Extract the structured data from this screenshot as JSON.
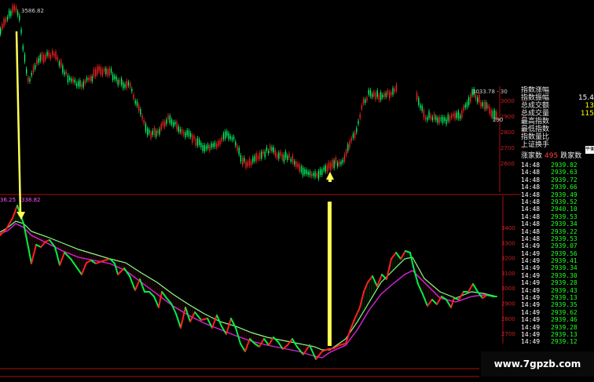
{
  "upper_chart": {
    "peak_label": "3586.82",
    "right_label": "3033.78 - 30",
    "right_value": "290",
    "axis_ticks": [
      "3000",
      "2900",
      "2800",
      "2700",
      "2600"
    ]
  },
  "lower_chart": {
    "top_label_left": "36.25",
    "top_label_right": "338.82",
    "axis_ticks": [
      "3400",
      "3300",
      "3200",
      "3100",
      "3000",
      "2900",
      "2800",
      "2700"
    ]
  },
  "info_panel": {
    "rows": [
      {
        "label": "指数涨幅",
        "value": ""
      },
      {
        "label": "指数振幅",
        "value": "15.4"
      },
      {
        "label": "总成交额",
        "value": "13"
      },
      {
        "label": "总成交量",
        "value": "115"
      },
      {
        "label": "最高指数",
        "value": ""
      },
      {
        "label": "最低指数",
        "value": ""
      },
      {
        "label": "指数量比",
        "value": ""
      },
      {
        "label": "上证换手",
        "value": ""
      }
    ],
    "advance_label": "涨家数",
    "advance_count": "495",
    "decline_label": "跌家数"
  },
  "ticks": [
    {
      "time": "14:48",
      "price": "2939.82"
    },
    {
      "time": "14:48",
      "price": "2939.63"
    },
    {
      "time": "14:48",
      "price": "2939.72"
    },
    {
      "time": "14:48",
      "price": "2939.66"
    },
    {
      "time": "14:48",
      "price": "2939.49"
    },
    {
      "time": "14:48",
      "price": "2939.52"
    },
    {
      "time": "14:48",
      "price": "2940.10"
    },
    {
      "time": "14:48",
      "price": "2939.53"
    },
    {
      "time": "14:48",
      "price": "2939.34"
    },
    {
      "time": "14:48",
      "price": "2939.22"
    },
    {
      "time": "14:48",
      "price": "2939.53"
    },
    {
      "time": "14:49",
      "price": "2939.07"
    },
    {
      "time": "14:49",
      "price": "2939.56"
    },
    {
      "time": "14:49",
      "price": "2939.41"
    },
    {
      "time": "14:49",
      "price": "2939.34"
    },
    {
      "time": "14:49",
      "price": "2939.30"
    },
    {
      "time": "14:49",
      "price": "2939.28"
    },
    {
      "time": "14:49",
      "price": "2939.43"
    },
    {
      "time": "14:49",
      "price": "2939.13"
    },
    {
      "time": "14:49",
      "price": "2939.35"
    },
    {
      "time": "14:49",
      "price": "2939.62"
    },
    {
      "time": "14:49",
      "price": "2939.46"
    },
    {
      "time": "14:49",
      "price": "2939.28"
    },
    {
      "time": "14:49",
      "price": "2939.13"
    },
    {
      "time": "14:49",
      "price": "2939.12"
    }
  ],
  "tooltip_text": "平衡",
  "watermark": "www.7gpzb.com",
  "colors": {
    "up": "#ff2222",
    "down": "#00ff66",
    "rise_segment": "#ff2020",
    "fall_segment": "#00ee44",
    "ma_line": "#dd22dd",
    "envelope_line": "#88ff88",
    "arrow": "#ffff55",
    "axis": "#aa1111"
  }
}
